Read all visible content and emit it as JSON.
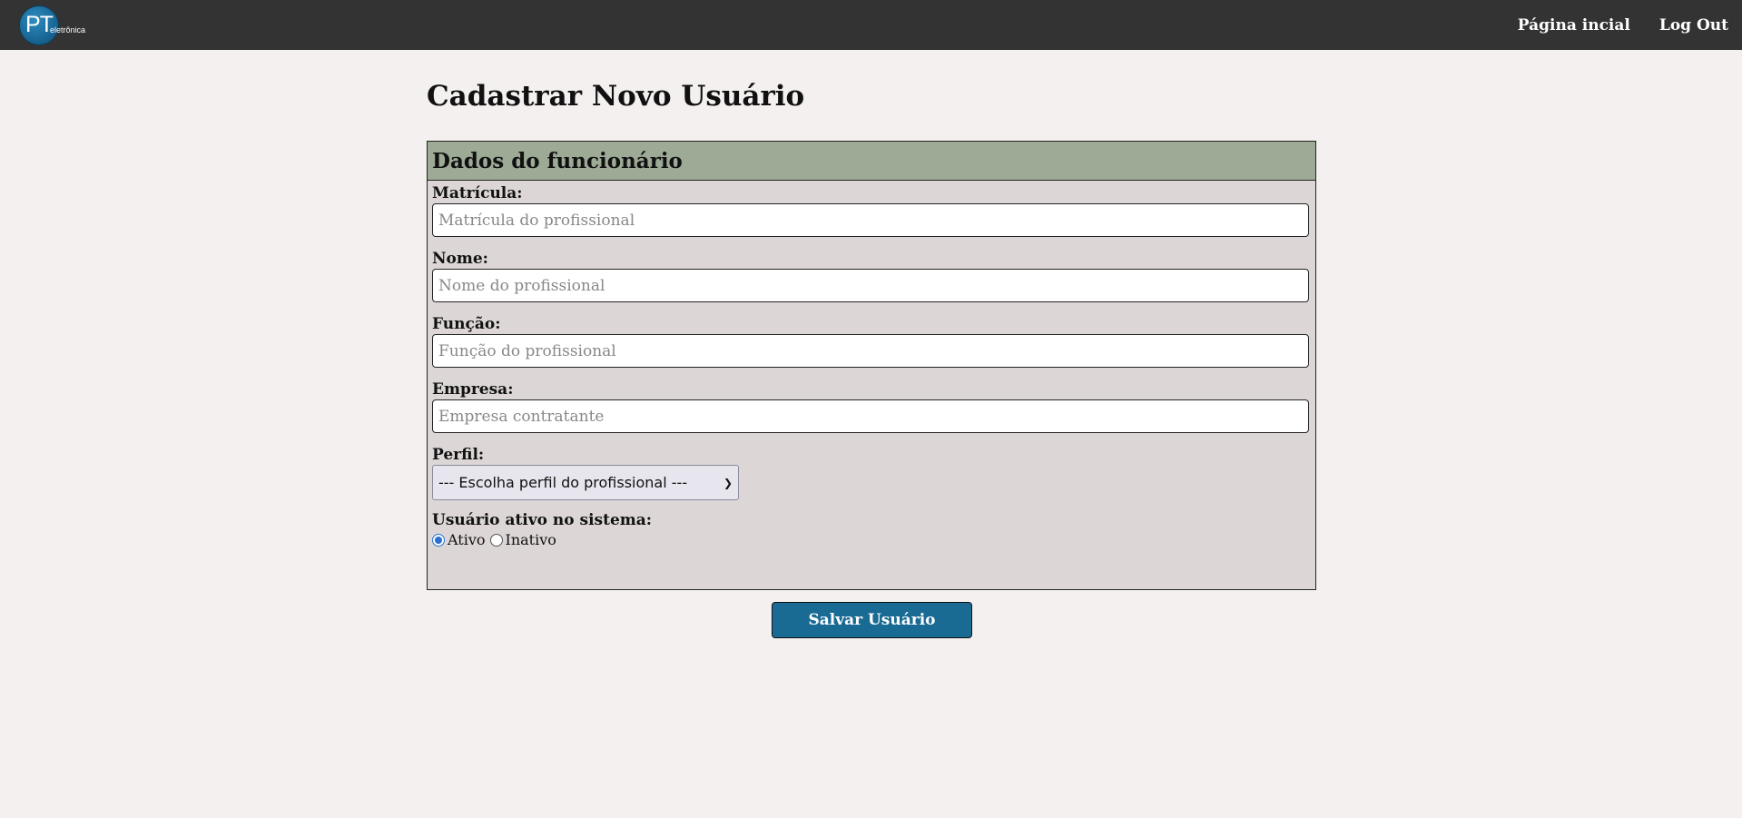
{
  "header": {
    "logo_text": "PT",
    "logo_subtext": "eletrônica",
    "nav": [
      {
        "label": "Página incial"
      },
      {
        "label": "Log Out"
      }
    ]
  },
  "page": {
    "title": "Cadastrar Novo Usuário"
  },
  "form": {
    "section_title": "Dados do funcionário",
    "fields": [
      {
        "label": "Matrícula:",
        "placeholder": "Matrícula do profissional",
        "value": ""
      },
      {
        "label": "Nome:",
        "placeholder": "Nome do profissional",
        "value": ""
      },
      {
        "label": "Função:",
        "placeholder": "Função do profissional",
        "value": ""
      },
      {
        "label": "Empresa:",
        "placeholder": "Empresa contratante",
        "value": ""
      }
    ],
    "profile": {
      "label": "Perfil:",
      "selected": "--- Escolha perfil do profissional ---"
    },
    "status": {
      "label": "Usuário ativo no sistema:",
      "options": [
        {
          "label": "Ativo",
          "checked": true
        },
        {
          "label": "Inativo",
          "checked": false
        }
      ]
    },
    "submit_label": "Salvar Usuário"
  },
  "colors": {
    "topbar": "#333333",
    "background": "#f4f0ef",
    "panel": "#dcd7d6",
    "panel_header": "#9caa96",
    "button": "#1a6b94"
  }
}
